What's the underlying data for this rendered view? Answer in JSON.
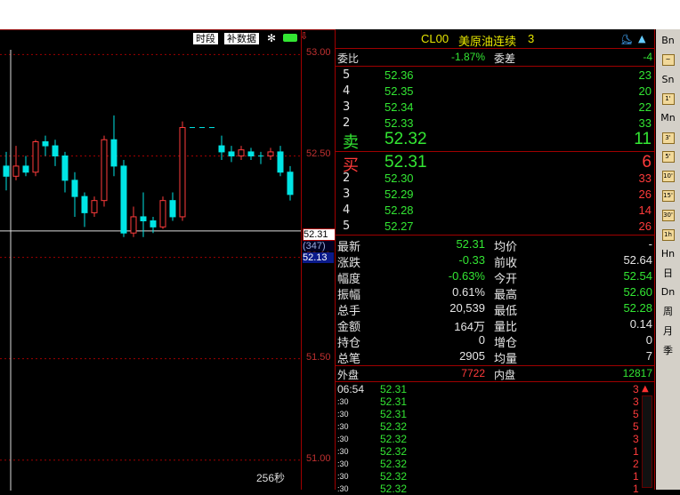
{
  "toolbar": {
    "shiduan": "时段",
    "bushuju": "补数据"
  },
  "chart": {
    "y_labels": [
      "53.00",
      "52.50",
      "52.00",
      "51.50",
      "51.00"
    ],
    "y_values": [
      53.0,
      52.5,
      52.0,
      51.5,
      51.0
    ],
    "current_price": "52.31",
    "volume_tag": "(347)",
    "crosshair_price": "52.13",
    "period_label": "256秒",
    "candles": [
      {
        "o": 52.45,
        "c": 52.4,
        "h": 52.52,
        "l": 52.33
      },
      {
        "o": 52.4,
        "c": 52.45,
        "h": 52.55,
        "l": 52.38
      },
      {
        "o": 52.45,
        "c": 52.42,
        "h": 52.5,
        "l": 52.4
      },
      {
        "o": 52.42,
        "c": 52.57,
        "h": 52.58,
        "l": 52.4
      },
      {
        "o": 52.57,
        "c": 52.55,
        "h": 52.6,
        "l": 52.5
      },
      {
        "o": 52.55,
        "c": 52.5,
        "h": 52.58,
        "l": 52.45
      },
      {
        "o": 52.5,
        "c": 52.38,
        "h": 52.52,
        "l": 52.32
      },
      {
        "o": 52.38,
        "c": 52.3,
        "h": 52.42,
        "l": 52.2
      },
      {
        "o": 52.3,
        "c": 52.22,
        "h": 52.32,
        "l": 52.15
      },
      {
        "o": 52.22,
        "c": 52.28,
        "h": 52.3,
        "l": 52.2
      },
      {
        "o": 52.28,
        "c": 52.58,
        "h": 52.6,
        "l": 52.25
      },
      {
        "o": 52.58,
        "c": 52.45,
        "h": 52.7,
        "l": 52.4
      },
      {
        "o": 52.45,
        "c": 52.12,
        "h": 52.48,
        "l": 52.1
      },
      {
        "o": 52.12,
        "c": 52.2,
        "h": 52.25,
        "l": 52.1
      },
      {
        "o": 52.2,
        "c": 52.18,
        "h": 52.32,
        "l": 52.1
      },
      {
        "o": 52.18,
        "c": 52.15,
        "h": 52.2,
        "l": 52.12
      },
      {
        "o": 52.15,
        "c": 52.28,
        "h": 52.3,
        "l": 52.14
      },
      {
        "o": 52.28,
        "c": 52.2,
        "h": 52.32,
        "l": 52.18
      },
      {
        "o": 52.2,
        "c": 52.64,
        "h": 52.67,
        "l": 52.18
      },
      {
        "o": 52.64,
        "c": 52.64,
        "h": 52.64,
        "l": 52.64
      },
      {
        "o": 52.64,
        "c": 52.64,
        "h": 52.64,
        "l": 52.64
      },
      {
        "o": 52.64,
        "c": 52.64,
        "h": 52.64,
        "l": 52.64
      },
      {
        "o": 52.55,
        "c": 52.52,
        "h": 52.6,
        "l": 52.48
      },
      {
        "o": 52.52,
        "c": 52.5,
        "h": 52.55,
        "l": 52.47
      },
      {
        "o": 52.5,
        "c": 52.53,
        "h": 52.55,
        "l": 52.48
      },
      {
        "o": 52.52,
        "c": 52.5,
        "h": 52.54,
        "l": 52.48
      },
      {
        "o": 52.5,
        "c": 52.5,
        "h": 52.52,
        "l": 52.46
      },
      {
        "o": 52.5,
        "c": 52.52,
        "h": 52.54,
        "l": 52.48
      },
      {
        "o": 52.52,
        "c": 52.42,
        "h": 52.55,
        "l": 52.4
      },
      {
        "o": 52.42,
        "c": 52.31,
        "h": 52.45,
        "l": 52.28
      }
    ]
  },
  "header": {
    "symbol": "CL00",
    "name": "美原油连续",
    "num": "3"
  },
  "weibi": {
    "label1": "委比",
    "value1": "-1.87%",
    "label2": "委差",
    "value2": "-4"
  },
  "asks": [
    {
      "level": "5",
      "price": "52.36",
      "vol": "23"
    },
    {
      "level": "4",
      "price": "52.35",
      "vol": "20"
    },
    {
      "level": "3",
      "price": "52.34",
      "vol": "22"
    },
    {
      "level": "2",
      "price": "52.33",
      "vol": "33"
    },
    {
      "level": "卖",
      "price": "52.32",
      "vol": "11"
    }
  ],
  "bids": [
    {
      "level": "买",
      "price": "52.31",
      "vol": "6"
    },
    {
      "level": "2",
      "price": "52.30",
      "vol": "33"
    },
    {
      "level": "3",
      "price": "52.29",
      "vol": "26"
    },
    {
      "level": "4",
      "price": "52.28",
      "vol": "14"
    },
    {
      "level": "5",
      "price": "52.27",
      "vol": "26"
    }
  ],
  "stats": [
    {
      "l1": "最新",
      "v1": "52.31",
      "c1": "g",
      "l2": "均价",
      "v2": "-",
      "c2": "w"
    },
    {
      "l1": "涨跌",
      "v1": "-0.33",
      "c1": "g",
      "l2": "前收",
      "v2": "52.64",
      "c2": "w"
    },
    {
      "l1": "幅度",
      "v1": "-0.63%",
      "c1": "g",
      "l2": "今开",
      "v2": "52.54",
      "c2": "g"
    },
    {
      "l1": "振幅",
      "v1": "0.61%",
      "c1": "w",
      "l2": "最高",
      "v2": "52.60",
      "c2": "g"
    },
    {
      "l1": "总手",
      "v1": "20,539",
      "c1": "w",
      "l2": "最低",
      "v2": "52.28",
      "c2": "g"
    },
    {
      "l1": "金额",
      "v1": "164万",
      "c1": "w",
      "l2": "量比",
      "v2": "0.14",
      "c2": "w"
    },
    {
      "l1": "持仓",
      "v1": "0",
      "c1": "w",
      "l2": "增仓",
      "v2": "0",
      "c2": "w"
    },
    {
      "l1": "总笔",
      "v1": "2905",
      "c1": "w",
      "l2": "均量",
      "v2": "7",
      "c2": "w"
    }
  ],
  "outer": {
    "l1": "外盘",
    "v1": "7722",
    "l2": "内盘",
    "v2": "12817"
  },
  "ticks": [
    {
      "t": "06:54",
      "p": "52.31",
      "v": "3"
    },
    {
      "t": ":30",
      "p": "52.31",
      "v": "3"
    },
    {
      "t": ":30",
      "p": "52.31",
      "v": "5"
    },
    {
      "t": ":30",
      "p": "52.32",
      "v": "5"
    },
    {
      "t": ":30",
      "p": "52.32",
      "v": "3"
    },
    {
      "t": ":30",
      "p": "52.32",
      "v": "1"
    },
    {
      "t": ":30",
      "p": "52.32",
      "v": "2"
    },
    {
      "t": ":30",
      "p": "52.32",
      "v": "1"
    },
    {
      "t": ":30",
      "p": "52.32",
      "v": "1"
    }
  ],
  "sidebar": [
    {
      "label": "Bn",
      "icon": false
    },
    {
      "label": "",
      "icon": true,
      "icon_text": "~"
    },
    {
      "label": "Sn",
      "icon": false
    },
    {
      "label": "",
      "icon": true,
      "icon_text": "1'"
    },
    {
      "label": "Mn",
      "icon": false
    },
    {
      "label": "",
      "icon": true,
      "icon_text": "3'"
    },
    {
      "label": "",
      "icon": true,
      "icon_text": "5'"
    },
    {
      "label": "",
      "icon": true,
      "icon_text": "10'"
    },
    {
      "label": "",
      "icon": true,
      "icon_text": "15'"
    },
    {
      "label": "",
      "icon": true,
      "icon_text": "30'"
    },
    {
      "label": "",
      "icon": true,
      "icon_text": "1h"
    },
    {
      "label": "Hn",
      "icon": false
    },
    {
      "label": "日",
      "icon": false
    },
    {
      "label": "Dn",
      "icon": false
    },
    {
      "label": "周",
      "icon": false
    },
    {
      "label": "月",
      "icon": false
    },
    {
      "label": "季",
      "icon": false
    }
  ],
  "colors": {
    "up": "#ff3b3b",
    "down": "#00e5e5",
    "grid": "#a00000",
    "green": "#33e633"
  }
}
